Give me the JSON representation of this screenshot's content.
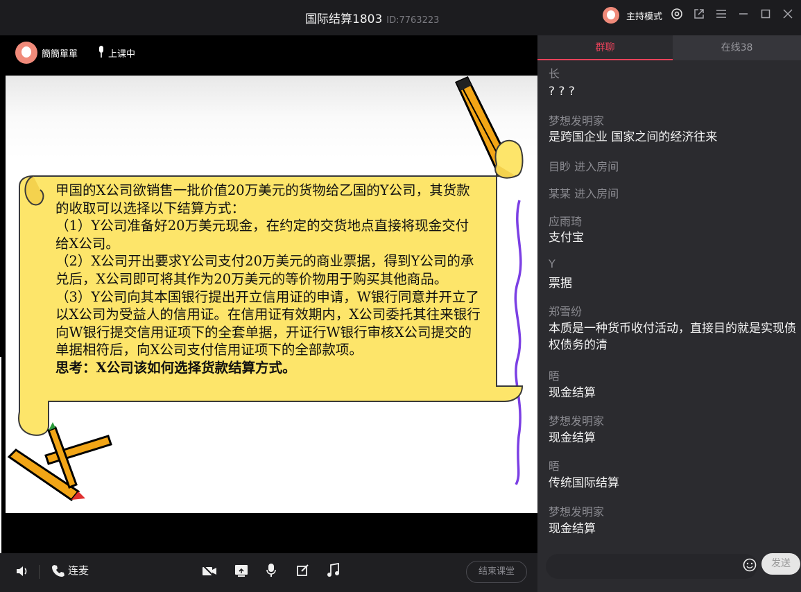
{
  "window": {
    "title": "国际结算1803",
    "room_id": "ID:7763223",
    "host_mode_label": "主持模式"
  },
  "stage": {
    "teacher_name": "簡簡單單",
    "class_status": "上课中"
  },
  "slide": {
    "lines": [
      "甲国的X公司欲销售一批价值20万美元的货物给乙国的Y公司，其货款",
      "的收取可以选择以下结算方式：",
      "（1）Y公司准备好20万美元现金，在约定的交货地点直接将现金交付",
      "给X公司。",
      "（2）X公司开出要求Y公司支付20万美元的商业票据，得到Y公司的承",
      "兑后，X公司即可将其作为20万美元的等价物用于购买其他商品。",
      "（3）Y公司向其本国银行提出开立信用证的申请，W银行同意并开立了",
      "以X公司为受益人的信用证。在信用证有效期内，X公司委托其往来银行",
      "向W银行提交信用证项下的全套单据，开证行W银行审核X公司提交的",
      "单据相符后，向X公司支付信用证项下的全部款项。"
    ],
    "question": "思考：X公司该如何选择货款结算方式。"
  },
  "toolbar": {
    "lianmai_label": "连麦",
    "end_class_label": "结束课堂"
  },
  "chat": {
    "tab_chat": "群聊",
    "tab_online": "在线38",
    "messages": [
      {
        "name": "长",
        "text": "? ? ?"
      },
      {
        "name": "梦想发明家",
        "text": "是跨国企业 国家之间的经济往来"
      },
      {
        "name": "",
        "text": "目眇 进入房间"
      },
      {
        "name": "",
        "text": "某某 进入房间"
      },
      {
        "name": "应雨琦",
        "text": "支付宝"
      },
      {
        "name": "Y",
        "text": "票据"
      },
      {
        "name": "郑雪纷",
        "text": "本质是一种货币收付活动，直接目的就是实现债权债务的清"
      },
      {
        "name": "晤",
        "text": "现金结算"
      },
      {
        "name": "梦想发明家",
        "text": "现金结算"
      },
      {
        "name": "晤",
        "text": "传统国际结算"
      },
      {
        "name": "梦想发明家",
        "text": "现金结算"
      }
    ],
    "send_label": "发送",
    "input_placeholder": ""
  },
  "colors": {
    "accent": "#e8425a",
    "scroll_fill": "#fde56a",
    "panel_bg": "#2b2b2f"
  }
}
